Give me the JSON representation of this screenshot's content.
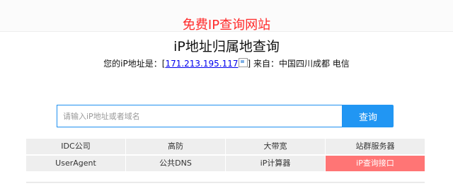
{
  "header": {
    "site_link": "免费IP查询网站"
  },
  "main": {
    "title": "iP地址归属地查询",
    "ip_prefix": "您的iP地址是：[",
    "ip": "171.213.195.117",
    "ip_suffix": "] 来自：中国四川成都 电信"
  },
  "search": {
    "placeholder": "请输入iP地址或者域名",
    "button_label": "查询"
  },
  "links": [
    {
      "label": "IDC公司",
      "active": false
    },
    {
      "label": "高防",
      "active": false
    },
    {
      "label": "大带宽",
      "active": false
    },
    {
      "label": "站群服务器",
      "active": false
    },
    {
      "label": "UserAgent",
      "active": false
    },
    {
      "label": "公共DNS",
      "active": false
    },
    {
      "label": "iP计算器",
      "active": false
    },
    {
      "label": "iP查询接口",
      "active": true
    }
  ],
  "colors": {
    "site_link": "#ff2a2a",
    "search_button": "#2196f3",
    "active_link": "#ff7575"
  }
}
